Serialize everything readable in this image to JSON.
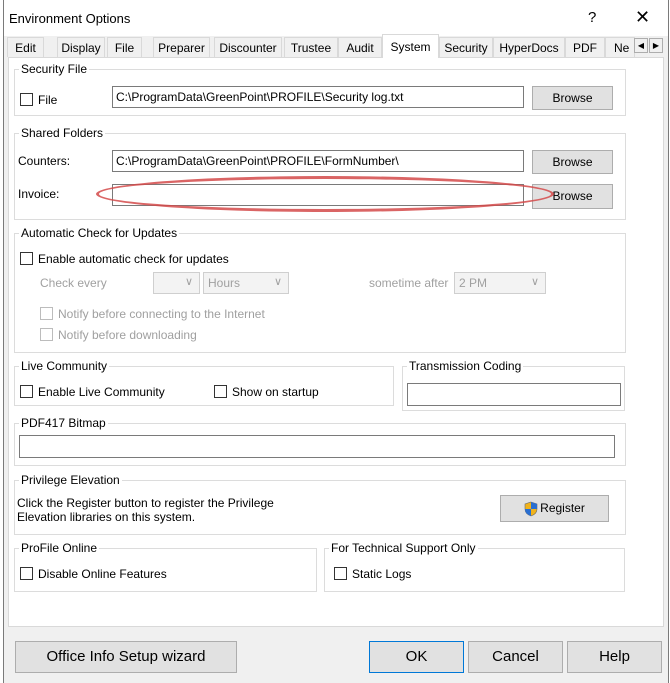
{
  "window": {
    "title": "Environment Options",
    "help_glyph": "?",
    "close_glyph": "✕"
  },
  "tabs": [
    {
      "label": "Edit"
    },
    {
      "label": "Display"
    },
    {
      "label": "File"
    },
    {
      "label": "Preparer"
    },
    {
      "label": "Discounter"
    },
    {
      "label": "Trustee"
    },
    {
      "label": "Audit"
    },
    {
      "label": "System",
      "active": true
    },
    {
      "label": "Security"
    },
    {
      "label": "HyperDocs"
    },
    {
      "label": "PDF"
    },
    {
      "label": "Ne"
    }
  ],
  "security_file": {
    "group_label": "Security File",
    "file_checkbox_label": "File",
    "file_path": "C:\\ProgramData\\GreenPoint\\PROFILE\\Security log.txt",
    "browse_label": "Browse"
  },
  "shared_folders": {
    "group_label": "Shared Folders",
    "counters_label": "Counters:",
    "counters_path": "C:\\ProgramData\\GreenPoint\\PROFILE\\FormNumber\\",
    "invoice_label": "Invoice:",
    "invoice_path": "",
    "browse_label": "Browse"
  },
  "auto_update": {
    "group_label": "Automatic Check for Updates",
    "enable_label": "Enable automatic check for updates",
    "check_every_label": "Check every",
    "interval_value": "",
    "unit_value": "Hours",
    "sometime_after_label": "sometime after",
    "time_value": "2 PM",
    "notify_connect_label": "Notify before connecting to the Internet",
    "notify_download_label": "Notify before downloading"
  },
  "live_community": {
    "group_label": "Live Community",
    "enable_label": "Enable Live Community",
    "startup_label": "Show on startup"
  },
  "transmission_coding": {
    "group_label": "Transmission Coding",
    "value": ""
  },
  "pdf417": {
    "group_label": "PDF417 Bitmap",
    "value": ""
  },
  "privilege": {
    "group_label": "Privilege Elevation",
    "description_line1": "Click the Register button to register the Privilege",
    "description_line2": "Elevation libraries on this system.",
    "register_label": "Register"
  },
  "profile_online": {
    "group_label": "ProFile Online",
    "disable_label": "Disable Online Features"
  },
  "tech_support": {
    "group_label": "For Technical Support Only",
    "static_logs_label": "Static Logs"
  },
  "footer": {
    "wizard_label": "Office Info Setup wizard",
    "ok_label": "OK",
    "cancel_label": "Cancel",
    "help_label": "Help"
  },
  "colors": {
    "highlight": "#d44a4a",
    "default_button_border": "#0078d7"
  }
}
